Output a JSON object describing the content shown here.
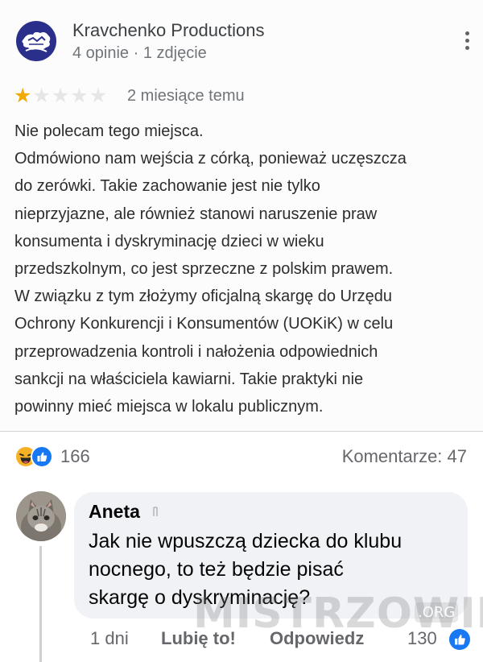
{
  "review": {
    "reviewer_name": "Kravchenko Productions",
    "reviewer_meta": "4 opinie · 1 zdjęcie",
    "rating": 1,
    "rating_max": 5,
    "time": "2 miesiące temu",
    "body_lines": [
      "Nie polecam tego miejsca.",
      "Odmówiono nam wejścia z córką, ponieważ uczęszcza",
      "do zerówki. Takie zachowanie jest nie tylko",
      "nieprzyjazne, ale również stanowi naruszenie praw",
      "konsumenta i dyskryminację dzieci w wieku",
      "przedszkolnym, co jest sprzeczne z polskim prawem.",
      "W związku z tym złożymy oficjalną skargę do Urzędu",
      "Ochrony Konkurencji i Konsumentów (UOKiK) w celu",
      "przeprowadzenia kontroli i nałożenia odpowiednich",
      "sankcji na właściciela kawiarni. Takie praktyki nie",
      "powinny mieć miejsca w lokalu publicznym."
    ]
  },
  "post_stats": {
    "reactions_count": "166",
    "comments_label": "Komentarze: 47"
  },
  "comment": {
    "author": "Aneta",
    "text_lines": [
      "Jak nie wpuszczą dziecka do klubu",
      "nocnego, to też będzie pisać",
      "skargę o dyskryminację?"
    ],
    "time": "1 dni",
    "like_label": "Lubię to!",
    "reply_label": "Odpowiedz",
    "likes_count": "130"
  },
  "watermark": {
    "text": "MISTRZOWIE",
    "suffix": ".ORG"
  },
  "colors": {
    "star_on": "#f2a900",
    "star_off": "#e6e6e6",
    "facebook_blue": "#1877f2",
    "haha_yellow": "#f7b125"
  },
  "icons": [
    "profile-logo-icon",
    "more-vert-icon",
    "star-icon",
    "haha-reaction-icon",
    "like-reaction-icon",
    "badge-icon",
    "like-small-icon"
  ]
}
